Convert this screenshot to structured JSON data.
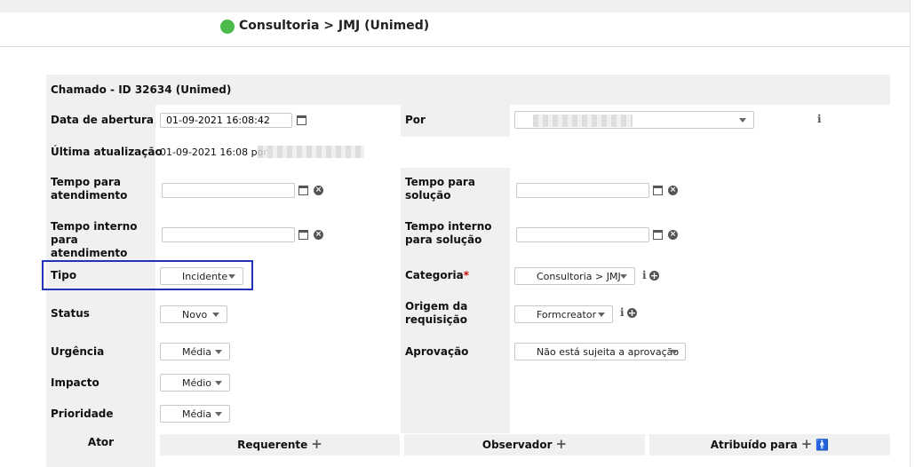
{
  "header": {
    "title": "Consultoria > JMJ (Unimed)",
    "status_color": "#4cbb4c"
  },
  "form": {
    "heading": "Chamado - ID 32634 (Unimed)",
    "opening_date_label": "Data de abertura",
    "opening_date_value": "01-09-2021 16:08:42",
    "by_label": "Por",
    "last_update_label": "Última atualização",
    "last_update_value": "01-09-2021 16:08 por",
    "time_to_own_label": "Tempo para atendimento",
    "time_to_resolve_label": "Tempo para solução",
    "internal_time_to_own_label": "Tempo interno para atendimento",
    "internal_time_to_resolve_label": "Tempo interno para solução",
    "type_label": "Tipo",
    "type_value": "Incidente",
    "category_label": "Categoria",
    "category_required": "*",
    "category_value": "Consultoria > JMJ",
    "status_label": "Status",
    "status_value": "Novo",
    "origin_label": "Origem da requisição",
    "origin_value": "Formcreator",
    "urgency_label": "Urgência",
    "urgency_value": "Média",
    "approval_label": "Aprovação",
    "approval_value": "Não está sujeita a aprovação",
    "impact_label": "Impacto",
    "impact_value": "Médio",
    "priority_label": "Prioridade",
    "priority_value": "Média"
  },
  "actors": {
    "actor_label": "Ator",
    "requester_label": "Requerente",
    "observer_label": "Observador",
    "assigned_label": "Atribuído para"
  },
  "icons": [
    "calendar-icon",
    "clear-icon",
    "info-icon",
    "add-icon",
    "caret-down-icon",
    "person-icon"
  ]
}
